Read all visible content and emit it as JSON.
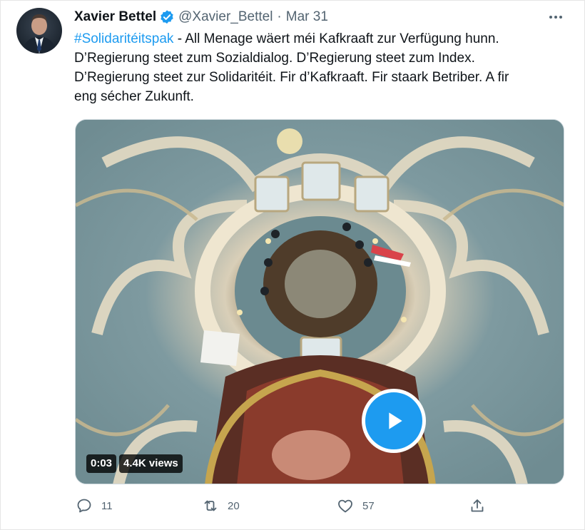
{
  "tweet": {
    "author_name": "Xavier Bettel",
    "handle": "@Xavier_Bettel",
    "separator": "·",
    "date": "Mar 31",
    "hashtag": "#Solidaritéitspak",
    "text_line1_rest": " - All Menage wäert méi Kafkraaft zur Verfügung hunn.",
    "text_line2": "D’Regierung steet zum Sozialdialog. D’Regierung steet zum Index.",
    "text_line3": "D’Regierung steet zur Solidaritéit. Fir d’Kafkraaft. Fir staark Betriber. A fir",
    "text_line4": "eng sécher Zukunft."
  },
  "video": {
    "duration": "0:03",
    "views": "4.4K views"
  },
  "actions": {
    "replies": "11",
    "retweets": "20",
    "likes": "57"
  },
  "colors": {
    "accent": "#1d9bf0",
    "secondary_text": "#536471"
  },
  "icons": [
    "verified-badge-icon",
    "more-icon",
    "play-icon",
    "reply-icon",
    "retweet-icon",
    "like-icon",
    "share-icon"
  ]
}
